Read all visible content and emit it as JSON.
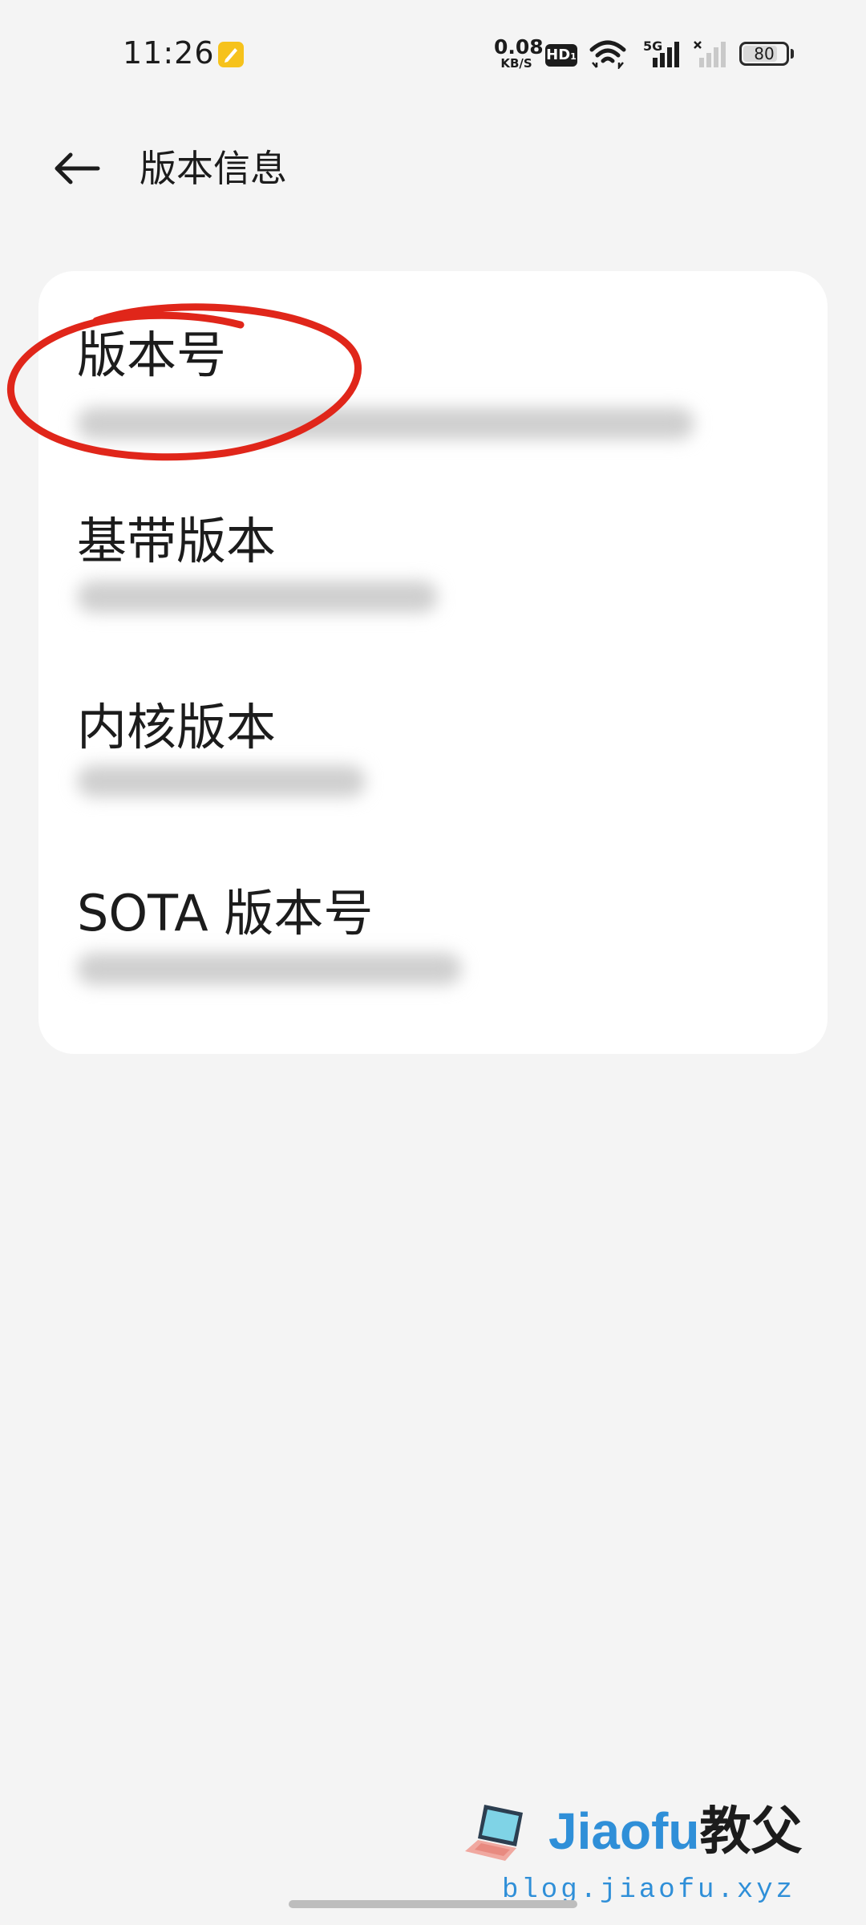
{
  "status_bar": {
    "time": "11:26",
    "net_speed_value": "0.08",
    "net_speed_unit": "KB/S",
    "hd_label": "HD",
    "hd_sub": "1",
    "network_label": "5G",
    "battery_level": "80",
    "battery_fraction": 0.8,
    "icons": [
      "note-icon",
      "hd-icon",
      "wifi-icon",
      "signal-icon",
      "signal-no-service-icon",
      "battery-icon"
    ]
  },
  "header": {
    "title": "版本信息",
    "back_icon": "back-arrow-icon"
  },
  "items": [
    {
      "label": "版本号"
    },
    {
      "label": "基带版本"
    },
    {
      "label": "内核版本"
    },
    {
      "label": "SOTA 版本号"
    }
  ],
  "annotation": {
    "color": "#e0261a"
  },
  "watermark": {
    "brand": "Jiaofu",
    "brand_cn": "教父",
    "url": "blog.jiaofu.xyz",
    "brand_color": "#2f8fd8"
  }
}
